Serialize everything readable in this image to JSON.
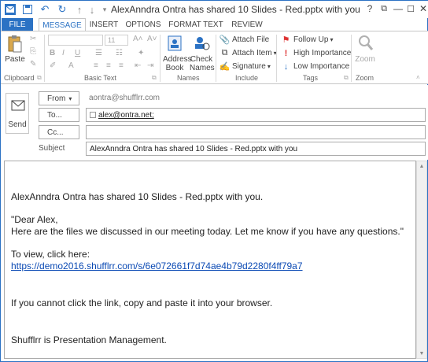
{
  "window": {
    "title": "AlexAnndra Ontra has shared 10 Slides - Red.pptx with you - Message (H...",
    "help": "?",
    "restore": "⧉",
    "minimize": "—",
    "maximize": "☐",
    "close": "✕"
  },
  "quick_access": {
    "save_icon": "save-icon",
    "undo_icon": "undo-icon",
    "redo_icon": "redo-icon",
    "up_icon": "up-arrow-icon",
    "down_icon": "down-arrow-icon",
    "more_icon": "customize-icon"
  },
  "tabs": [
    "FILE",
    "MESSAGE",
    "INSERT",
    "OPTIONS",
    "FORMAT TEXT",
    "REVIEW"
  ],
  "active_tab": "MESSAGE",
  "ribbon": {
    "clipboard": {
      "label": "Clipboard",
      "paste": "Paste"
    },
    "basic_text": {
      "label": "Basic Text",
      "font_size": "11",
      "bold": "B",
      "italic": "I",
      "underline": "U"
    },
    "names": {
      "label": "Names",
      "address_book": "Address\nBook",
      "check_names": "Check\nNames"
    },
    "include": {
      "label": "Include",
      "attach_file": "Attach File",
      "attach_item": "Attach Item",
      "signature": "Signature"
    },
    "tags": {
      "label": "Tags",
      "follow_up": "Follow Up",
      "high_importance": "High Importance",
      "low_importance": "Low Importance"
    },
    "zoom": {
      "label": "Zoom",
      "zoom": "Zoom"
    }
  },
  "compose": {
    "send": "Send",
    "from_label": "From",
    "from_value": "aontra@shufflrr.com",
    "to_label": "To...",
    "to_value": "alex@ontra.net;",
    "cc_label": "Cc...",
    "cc_value": "",
    "subject_label": "Subject",
    "subject_value": "AlexAnndra Ontra has shared 10 Slides - Red.pptx with you"
  },
  "body": {
    "line1": "AlexAnndra Ontra has shared 10 Slides - Red.pptx with you.",
    "line2": "\"Dear Alex,",
    "line3": "Here are the files we discussed in our meeting today.  Let me know if you have any questions.\"",
    "line4": "To view, click here:",
    "link": "https://demo2016.shufflrr.com/s/6e072661f7d74ae4b79d2280f4ff79a7",
    "line5": "If you cannot click the link, copy and paste it into your browser.",
    "line6": "Shufflrr is Presentation Management."
  },
  "colors": {
    "accent": "#2b72c4",
    "link": "#0b4ab4"
  }
}
